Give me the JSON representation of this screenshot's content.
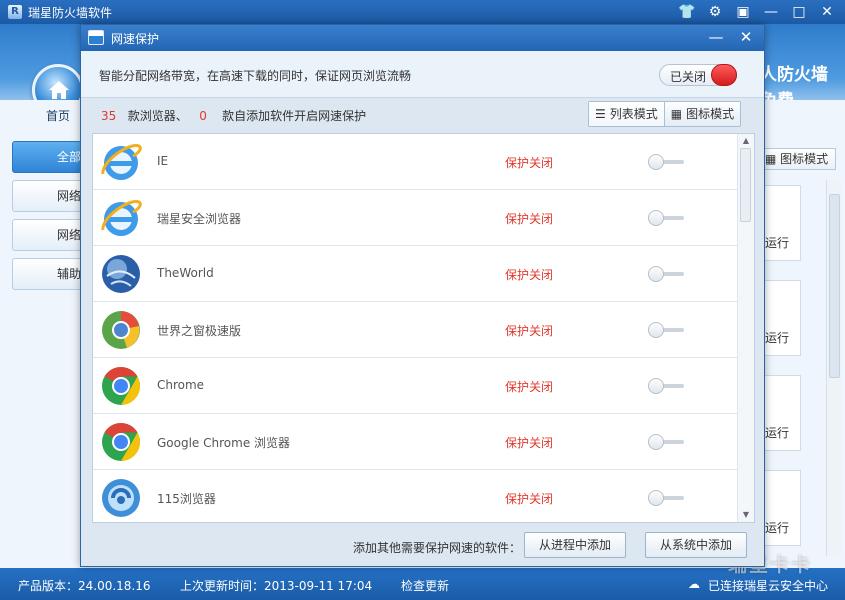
{
  "main_window": {
    "title": "瑞星防火墙软件",
    "slogan_line1": "人防火墙",
    "slogan_line2": "免费",
    "nav_home": "首页",
    "side_buttons": [
      "全部",
      "网络",
      "网络",
      "辅助"
    ],
    "icon_mode_label": "图标模式",
    "bg_card_text": "运行",
    "controls": {
      "skin": "shirt-icon",
      "settings": "gear-icon",
      "menu": "menu-icon",
      "minimize": "minimize-icon",
      "maximize": "maximize-icon",
      "close": "close-icon"
    }
  },
  "status_bar": {
    "version": "产品版本：24.00.18.16",
    "last_update": "上次更新时间：2013-09-11 17:04",
    "check_update": "检查更新",
    "cloud_text": "已连接瑞星云安全中心"
  },
  "watermark": "瑞星卡卡",
  "dialog": {
    "title": "网速保护",
    "description": "智能分配网络带宽，在高速下载的同时，保证网页浏览流畅",
    "toggle_label": "已关闭",
    "browser_count": "35",
    "count_text_1": "款浏览器、",
    "software_count": "0",
    "count_text_2": "款自添加软件开启网速保护",
    "list_mode_label": "列表模式",
    "icon_mode_label": "图标模式",
    "footer_label": "添加其他需要保护网速的软件：",
    "add_from_process": "从进程中添加",
    "add_from_system": "从系统中添加",
    "browsers": [
      {
        "name": "IE",
        "status": "保护关闭",
        "icon": "ie-icon"
      },
      {
        "name": "瑞星安全浏览器",
        "status": "保护关闭",
        "icon": "ie-icon"
      },
      {
        "name": "TheWorld",
        "status": "保护关闭",
        "icon": "theworld-globe-icon"
      },
      {
        "name": "世界之窗极速版",
        "status": "保护关闭",
        "icon": "theworld-chrome-icon"
      },
      {
        "name": "Chrome",
        "status": "保护关闭",
        "icon": "chrome-icon"
      },
      {
        "name": "Google Chrome 浏览器",
        "status": "保护关闭",
        "icon": "chrome-icon"
      },
      {
        "name": "115浏览器",
        "status": "保护关闭",
        "icon": "115-browser-icon"
      }
    ]
  },
  "colors": {
    "accent": "#2366b4",
    "status_off": "#e03a2f",
    "toggle_off": "#d41c1c"
  }
}
